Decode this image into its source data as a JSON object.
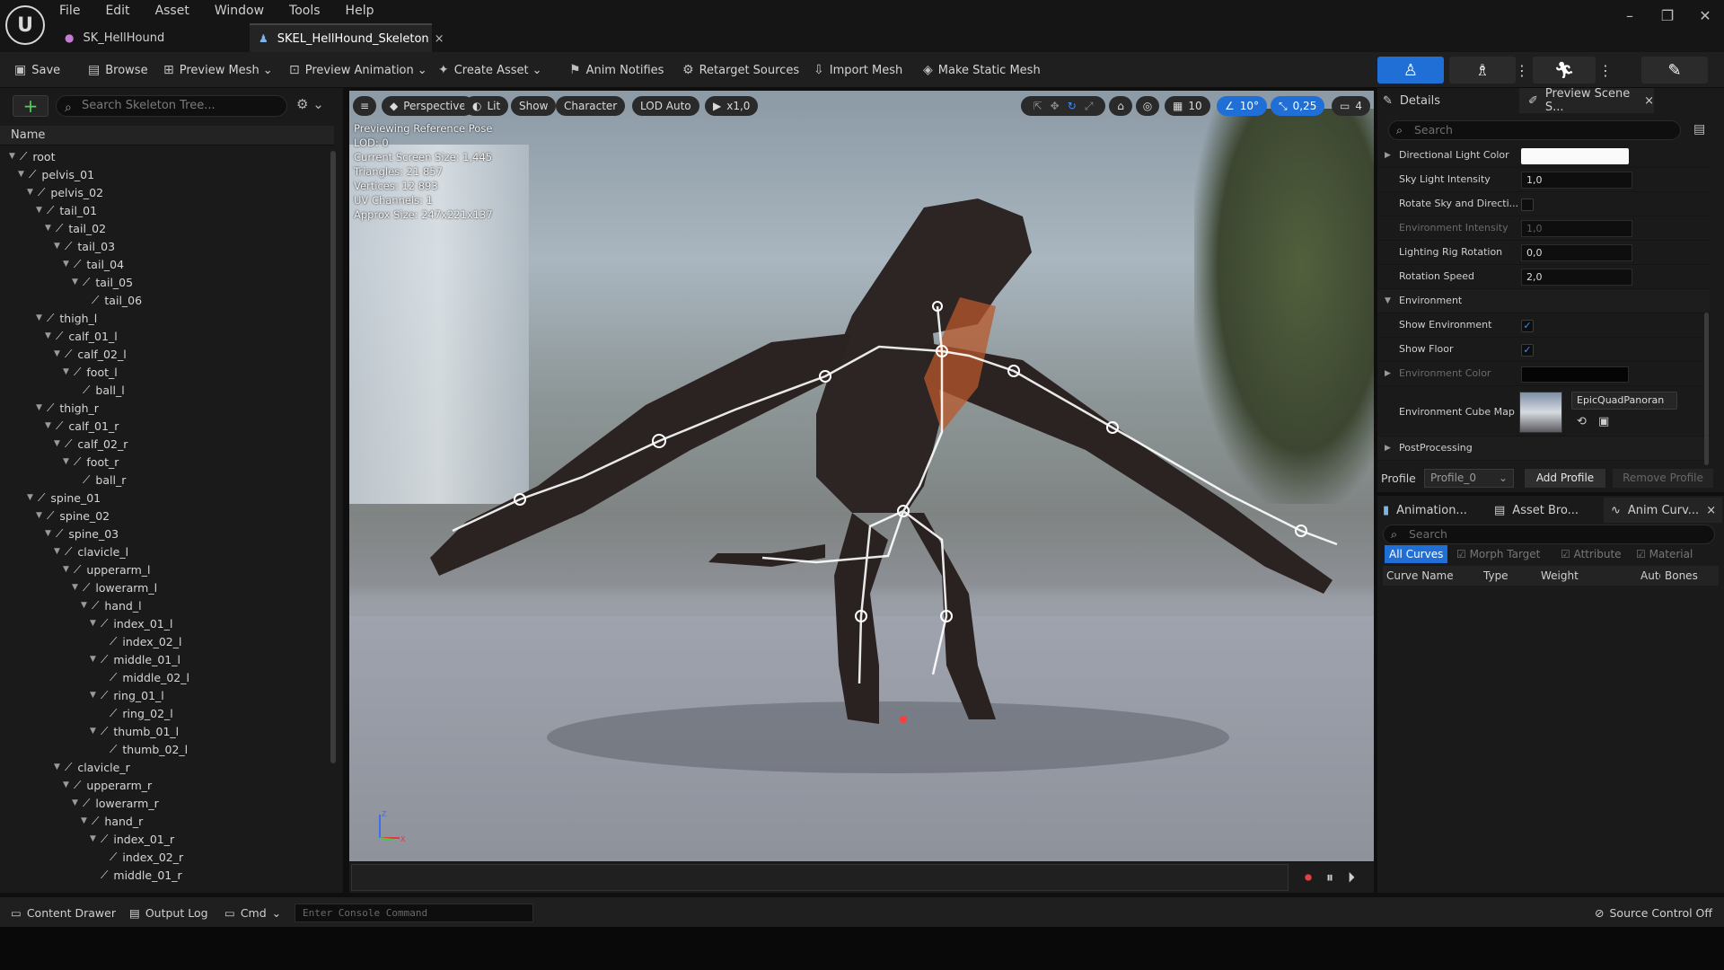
{
  "menu": [
    "File",
    "Edit",
    "Asset",
    "Window",
    "Tools",
    "Help"
  ],
  "tabs": [
    {
      "label": "SK_HellHound",
      "active": false
    },
    {
      "label": "SKEL_HellHound_Skeleton",
      "active": true
    }
  ],
  "toolbar": {
    "save": "Save",
    "browse": "Browse",
    "preview_mesh": "Preview Mesh",
    "preview_animation": "Preview Animation",
    "create_asset": "Create Asset",
    "anim_notifies": "Anim Notifies",
    "retarget_sources": "Retarget Sources",
    "import_mesh": "Import Mesh",
    "make_static_mesh": "Make Static Mesh"
  },
  "skeleton_tree": {
    "search_placeholder": "Search Skeleton Tree...",
    "column_name": "Name",
    "bones": [
      {
        "name": "root",
        "depth": 0
      },
      {
        "name": "pelvis_01",
        "depth": 1
      },
      {
        "name": "pelvis_02",
        "depth": 2
      },
      {
        "name": "tail_01",
        "depth": 3
      },
      {
        "name": "tail_02",
        "depth": 4
      },
      {
        "name": "tail_03",
        "depth": 5
      },
      {
        "name": "tail_04",
        "depth": 6
      },
      {
        "name": "tail_05",
        "depth": 7
      },
      {
        "name": "tail_06",
        "depth": 8
      },
      {
        "name": "thigh_l",
        "depth": 3
      },
      {
        "name": "calf_01_l",
        "depth": 4
      },
      {
        "name": "calf_02_l",
        "depth": 5
      },
      {
        "name": "foot_l",
        "depth": 6
      },
      {
        "name": "ball_l",
        "depth": 7
      },
      {
        "name": "thigh_r",
        "depth": 3
      },
      {
        "name": "calf_01_r",
        "depth": 4
      },
      {
        "name": "calf_02_r",
        "depth": 5
      },
      {
        "name": "foot_r",
        "depth": 6
      },
      {
        "name": "ball_r",
        "depth": 7
      },
      {
        "name": "spine_01",
        "depth": 2
      },
      {
        "name": "spine_02",
        "depth": 3
      },
      {
        "name": "spine_03",
        "depth": 4
      },
      {
        "name": "clavicle_l",
        "depth": 5
      },
      {
        "name": "upperarm_l",
        "depth": 6
      },
      {
        "name": "lowerarm_l",
        "depth": 7
      },
      {
        "name": "hand_l",
        "depth": 8
      },
      {
        "name": "index_01_l",
        "depth": 9
      },
      {
        "name": "index_02_l",
        "depth": 10
      },
      {
        "name": "middle_01_l",
        "depth": 9
      },
      {
        "name": "middle_02_l",
        "depth": 10
      },
      {
        "name": "ring_01_l",
        "depth": 9
      },
      {
        "name": "ring_02_l",
        "depth": 10
      },
      {
        "name": "thumb_01_l",
        "depth": 9
      },
      {
        "name": "thumb_02_l",
        "depth": 10
      },
      {
        "name": "clavicle_r",
        "depth": 5
      },
      {
        "name": "upperarm_r",
        "depth": 6
      },
      {
        "name": "lowerarm_r",
        "depth": 7
      },
      {
        "name": "hand_r",
        "depth": 8
      },
      {
        "name": "index_01_r",
        "depth": 9
      },
      {
        "name": "index_02_r",
        "depth": 10
      },
      {
        "name": "middle_01_r",
        "depth": 9
      }
    ]
  },
  "viewport": {
    "perspective": "Perspective",
    "lit": "Lit",
    "show": "Show",
    "character": "Character",
    "lod": "LOD Auto",
    "speed": "x1,0",
    "grid_snap": "10",
    "rot_snap": "10°",
    "scale_snap": "0,25",
    "cam_speed": "4",
    "info": [
      "Previewing Reference Pose",
      "LOD: 0",
      "Current Screen Size: 1,445",
      "Triangles: 21 857",
      "Vertices: 12 893",
      "UV Channels: 1",
      "Approx Size: 247x221x137"
    ]
  },
  "right_panel": {
    "tab_details": "Details",
    "tab_preview": "Preview Scene S...",
    "search_placeholder": "Search",
    "props": {
      "directional_light_color": "Directional Light Color",
      "sky_light_intensity": "Sky Light Intensity",
      "sky_light_intensity_val": "1,0",
      "rotate_sky": "Rotate Sky and Directi...",
      "environment_intensity": "Environment Intensity",
      "environment_intensity_val": "1,0",
      "lighting_rig_rotation": "Lighting Rig Rotation",
      "lighting_rig_rotation_val": "0,0",
      "rotation_speed": "Rotation Speed",
      "rotation_speed_val": "2,0",
      "environment": "Environment",
      "show_environment": "Show Environment",
      "show_floor": "Show Floor",
      "environment_color": "Environment Color",
      "environment_cube_map": "Environment Cube Map",
      "cube_map_val": "EpicQuadPanoran",
      "post_processing": "PostProcessing"
    },
    "profile_label": "Profile",
    "profile_val": "Profile_0",
    "add_profile": "Add Profile",
    "remove_profile": "Remove Profile",
    "bottom_tabs": [
      "Animation...",
      "Asset Bro...",
      "Anim Curv..."
    ],
    "curve_search": "Search",
    "filters": [
      "All Curves",
      "Morph Target",
      "Attribute",
      "Material"
    ],
    "columns": [
      "Curve Name",
      "Type",
      "Weight",
      "Auto",
      "Bones"
    ]
  },
  "statusbar": {
    "content_drawer": "Content Drawer",
    "output_log": "Output Log",
    "cmd": "Cmd",
    "console_placeholder": "Enter Console Command",
    "source_control": "Source Control Off"
  },
  "colors": {
    "accent": "#1f6fd6",
    "add": "#5ecb5e"
  }
}
